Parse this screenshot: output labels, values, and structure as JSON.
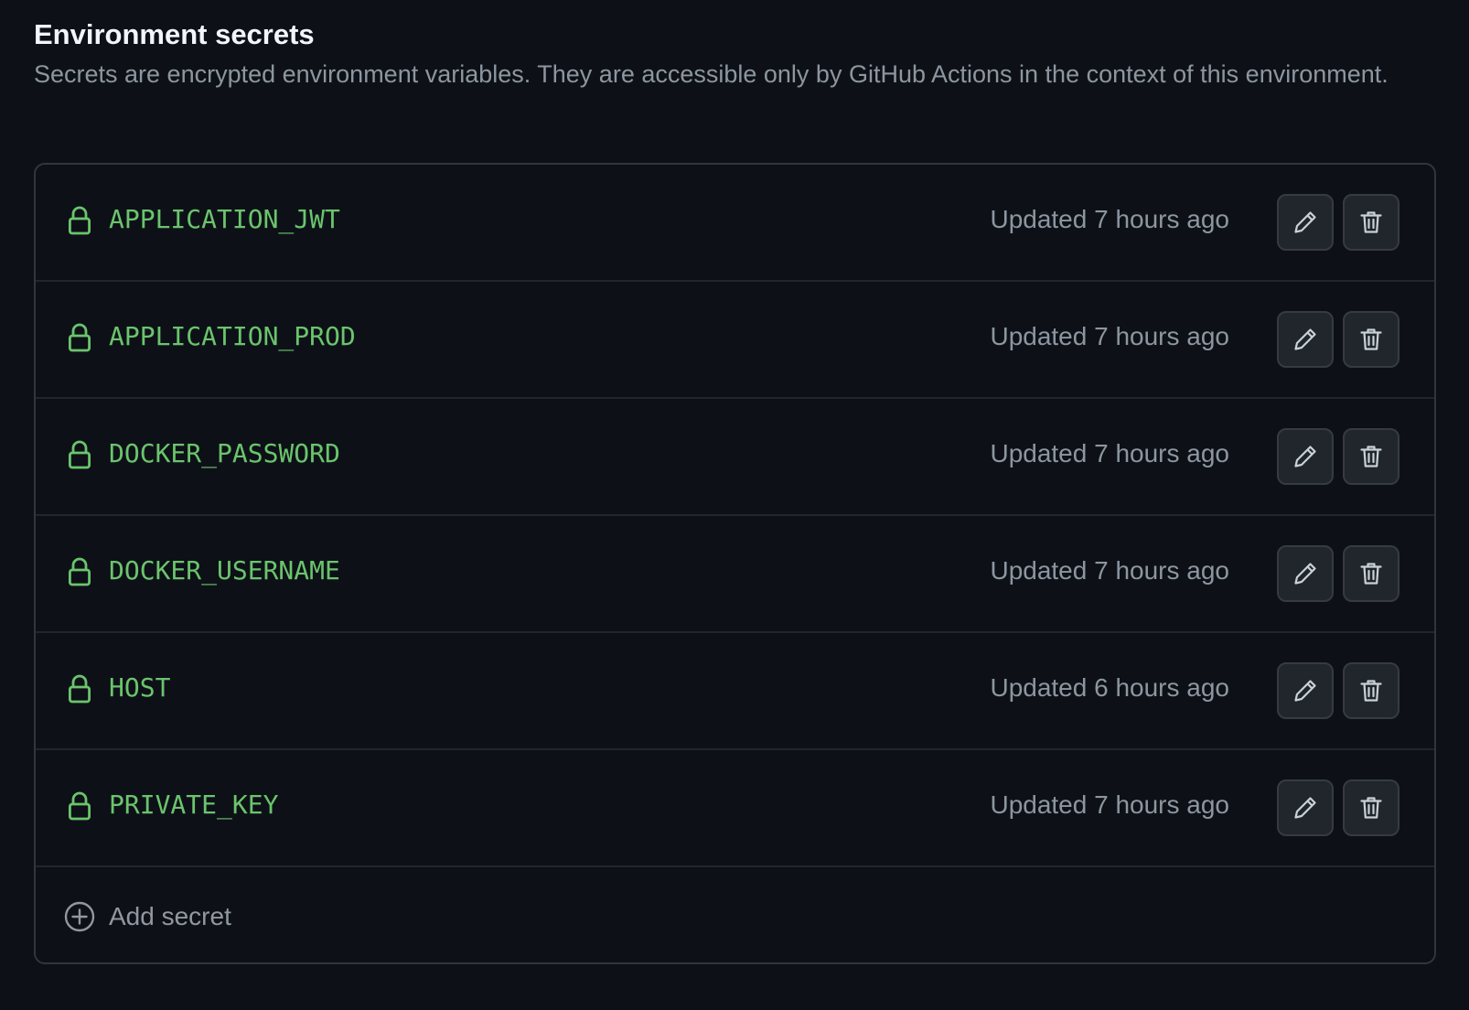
{
  "section": {
    "title": "Environment secrets",
    "description": "Secrets are encrypted environment variables. They are accessible only by GitHub Actions in the context of this environment."
  },
  "secrets": [
    {
      "name": "APPLICATION_JWT",
      "updated": "Updated 7 hours ago"
    },
    {
      "name": "APPLICATION_PROD",
      "updated": "Updated 7 hours ago"
    },
    {
      "name": "DOCKER_PASSWORD",
      "updated": "Updated 7 hours ago"
    },
    {
      "name": "DOCKER_USERNAME",
      "updated": "Updated 7 hours ago"
    },
    {
      "name": "HOST",
      "updated": "Updated 6 hours ago"
    },
    {
      "name": "PRIVATE_KEY",
      "updated": "Updated 7 hours ago"
    }
  ],
  "add": {
    "label": "Add secret"
  },
  "icons": {
    "row_icon": "lock-icon",
    "edit_icon": "pencil-icon",
    "delete_icon": "trash-icon",
    "add_icon": "plus-circle-icon"
  },
  "colors": {
    "background": "#0d1117",
    "secret_name": "#6bc46d",
    "muted_text": "#8d96a0",
    "border": "#30363d",
    "button_bg": "#21262d"
  }
}
